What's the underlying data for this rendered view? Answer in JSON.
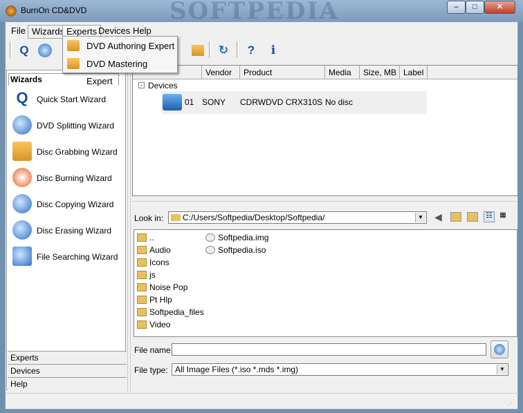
{
  "window": {
    "title": "BurnOn CD&DVD",
    "watermark": "SOFTPEDIA"
  },
  "menu": {
    "items": [
      "File",
      "Wizards",
      "Experts",
      "Devices",
      "Help"
    ],
    "open": "Experts"
  },
  "dropdown": {
    "items": [
      "DVD Authoring Expert",
      "DVD Mastering Expert"
    ]
  },
  "toolbar": {
    "icons": [
      "quick-start-icon",
      "dvd-splitting-icon",
      "disc-grabbing-icon",
      "authoring-expert-icon",
      "mastering-expert-icon",
      "refresh-icon",
      "help-icon",
      "info-icon"
    ],
    "glyphs": {
      "q": "Q",
      "help": "?",
      "info": "i",
      "refresh": "↻"
    }
  },
  "wizards": {
    "header": "Wizards",
    "items": [
      "Quick Start Wizard",
      "DVD Splitting Wizard",
      "Disc Grabbing Wizard",
      "Disc Burning Wizard",
      "Disc Copying Wizard",
      "Disc Erasing Wizard",
      "File Searching Wizard"
    ]
  },
  "bottom_tabs": [
    "Experts",
    "Devices",
    "Help"
  ],
  "devices": {
    "columns": [
      "",
      "Vendor",
      "Product",
      "Media",
      "Size, MB",
      "Label"
    ],
    "tree_root": "Devices",
    "rows": [
      {
        "id": "01",
        "vendor": "SONY",
        "product": "CDRWDVD CRX310S",
        "media": "No disc"
      }
    ]
  },
  "browser": {
    "look_in_label": "Look in:",
    "look_in_value": "C:/Users/Softpedia/Desktop/Softpedia/",
    "folders": [
      "..",
      "Audio",
      "Icons",
      "js",
      "Noise Pop",
      "Pt Hlp",
      "Softpedia_files",
      "Video"
    ],
    "files": [
      "Softpedia.img",
      "Softpedia.iso"
    ],
    "file_name_label": "File name:",
    "file_name_value": "",
    "file_type_label": "File type:",
    "file_type_value": "All Image Files (*.iso *.mds *.img)"
  }
}
